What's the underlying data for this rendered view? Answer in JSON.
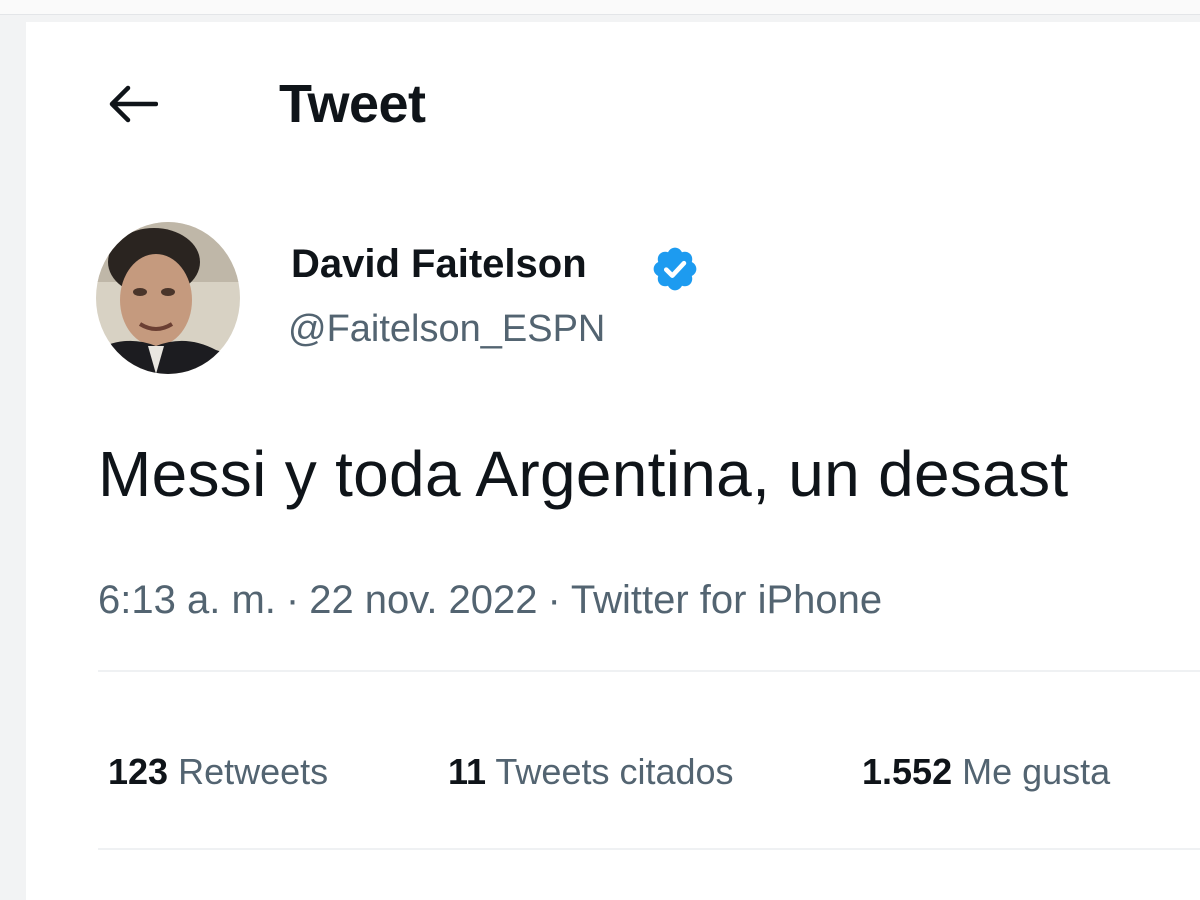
{
  "header": {
    "title": "Tweet",
    "back_icon": "arrow-left-icon"
  },
  "author": {
    "name": "David Faitelson",
    "handle": "@Faitelson_ESPN",
    "verified": true,
    "verified_icon": "verified-badge-icon",
    "verified_color": "#1d9bf0"
  },
  "tweet": {
    "text": "Messi y toda Argentina, un desast",
    "time": "6:13 a. m.",
    "separator": "·",
    "date": "22 nov. 2022",
    "source": "Twitter for iPhone"
  },
  "stats": {
    "retweets": {
      "count": "123",
      "label": "Retweets"
    },
    "quotes": {
      "count": "11",
      "label": "Tweets citados"
    },
    "likes": {
      "count": "1.552",
      "label": "Me gusta"
    }
  },
  "colors": {
    "text_primary": "#0f1419",
    "text_secondary": "#536471",
    "accent": "#1d9bf0"
  }
}
